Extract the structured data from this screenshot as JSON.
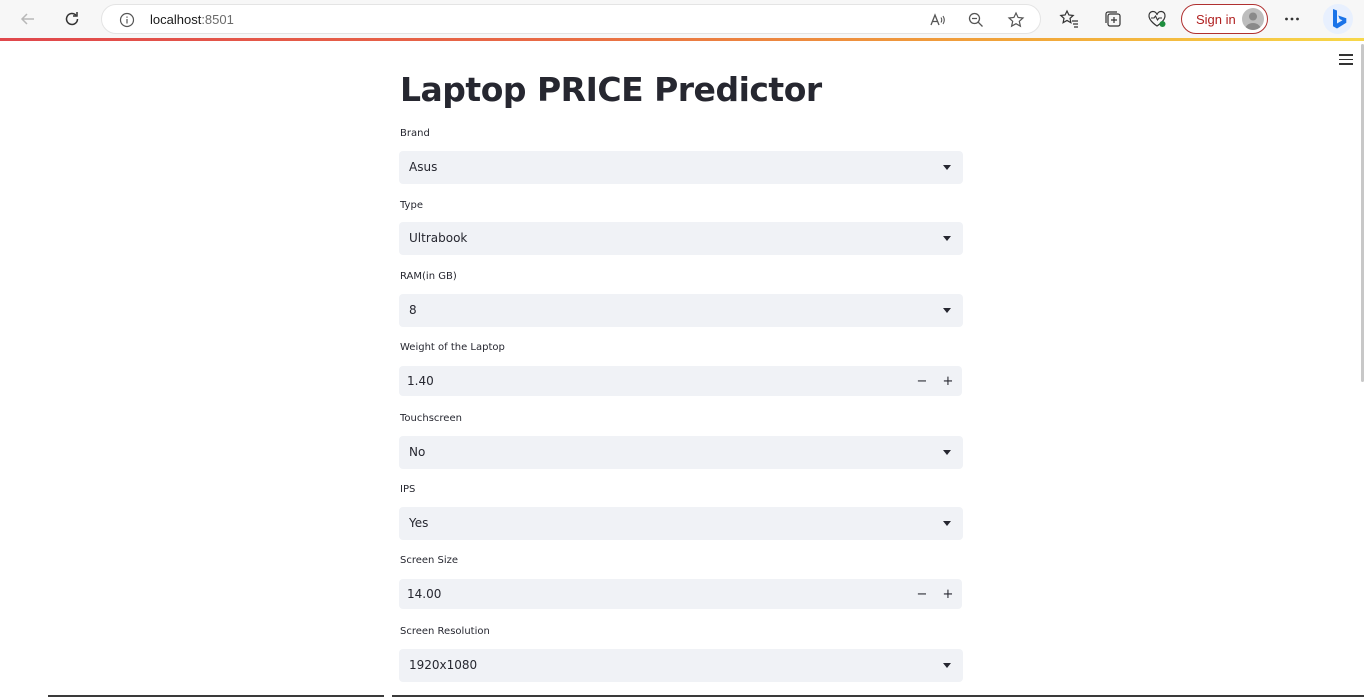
{
  "browser": {
    "url_host": "localhost",
    "url_port": ":8501",
    "sign_in_label": "Sign in"
  },
  "app": {
    "title": "Laptop PRICE Predictor",
    "fields": {
      "brand": {
        "label": "Brand",
        "value": "Asus"
      },
      "type": {
        "label": "Type",
        "value": "Ultrabook"
      },
      "ram": {
        "label": "RAM(in GB)",
        "value": "8"
      },
      "weight": {
        "label": "Weight of the Laptop",
        "value": "1.40",
        "minus": "−",
        "plus": "+"
      },
      "touchscreen": {
        "label": "Touchscreen",
        "value": "No"
      },
      "ips": {
        "label": "IPS",
        "value": "Yes"
      },
      "screen_size": {
        "label": "Screen Size",
        "value": "14.00",
        "minus": "−",
        "plus": "+"
      },
      "screen_resolution": {
        "label": "Screen Resolution",
        "value": "1920x1080"
      }
    }
  },
  "colors": {
    "accent": "#ff4b4b",
    "input_bg": "#f0f2f6",
    "text": "#262730"
  }
}
